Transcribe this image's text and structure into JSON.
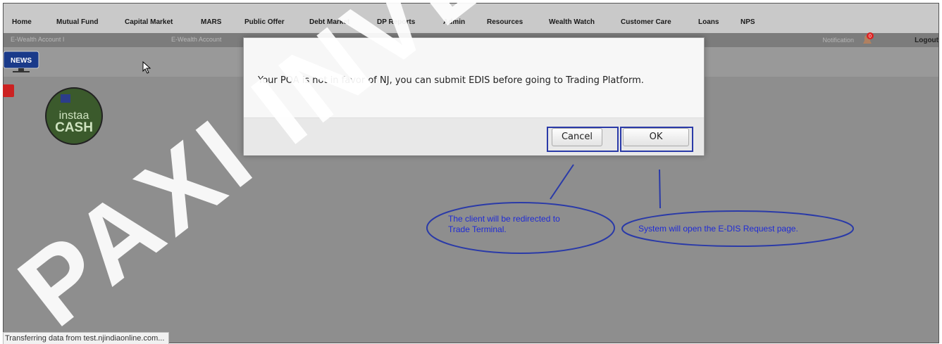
{
  "nav": {
    "items": [
      "Home",
      "Mutual Fund",
      "Capital Market",
      "MARS",
      "Public Offer",
      "Debt Market",
      "DP Reports",
      "Admin",
      "Resources",
      "Wealth Watch",
      "Customer Care",
      "Loans",
      "NPS"
    ]
  },
  "subbar": {
    "tabs": [
      "E-Wealth Account I",
      "E-Wealth Account"
    ],
    "notification_label": "Notification",
    "notification_count": "0",
    "logout_label": "Logout"
  },
  "news_label": "NEWS",
  "instaa": {
    "line1": "instaa",
    "line2": "CASH"
  },
  "dialog": {
    "message": "Your POA is not in favor of NJ, you can submit EDIS before going to Trading Platform.",
    "cancel_label": "Cancel",
    "ok_label": "OK"
  },
  "annotations": {
    "cancel_note_line1": "The client will be redirected to",
    "cancel_note_line2": "Trade Terminal.",
    "ok_note": "System will open the E-DIS Request page."
  },
  "status_bar": "Transferring data from test.njindiaonline.com...",
  "watermark": "PAXI INVE",
  "colors": {
    "annotation": "#2a3aa8",
    "overlay": "#8e8e8e",
    "nav": "#c9c9c9"
  }
}
